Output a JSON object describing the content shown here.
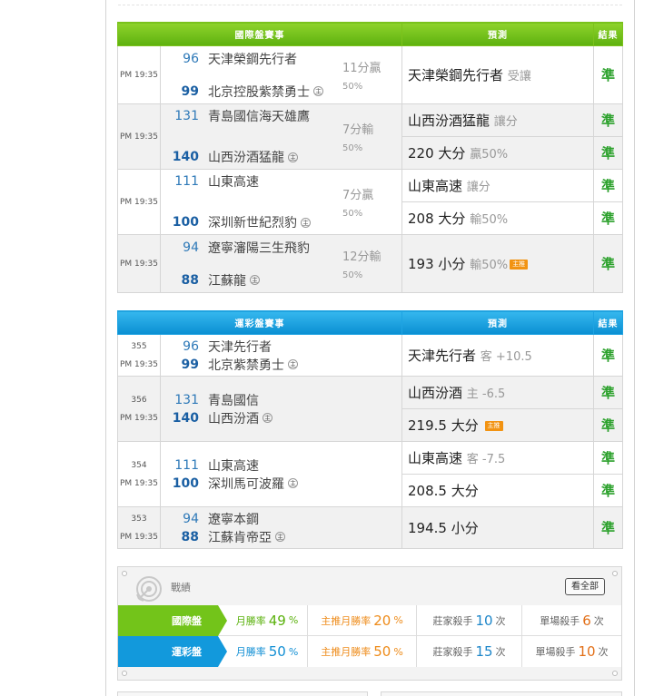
{
  "intl": {
    "header": {
      "games": "國際盤賽事",
      "prediction": "預測",
      "result": "結果"
    },
    "rows": [
      {
        "time": "PM 19:35",
        "away_num": "96",
        "away_name": "天津榮鋼先行者",
        "home_num": "99",
        "home_name": "北京控股紫禁勇士",
        "handicap": "11分贏",
        "handicap_pct": "50%",
        "preds": [
          {
            "main": "天津榮鋼先行者",
            "note": "受讓",
            "result": "準"
          }
        ]
      },
      {
        "time": "PM 19:35",
        "away_num": "131",
        "away_name": "青島國信海天雄鷹",
        "home_num": "140",
        "home_name": "山西汾酒猛龍",
        "handicap": "7分輸",
        "handicap_pct": "50%",
        "preds": [
          {
            "main": "山西汾酒猛龍",
            "note": "讓分",
            "result": "準"
          },
          {
            "main": "220 大分",
            "note": "贏50%",
            "result": "準"
          }
        ]
      },
      {
        "time": "PM 19:35",
        "away_num": "111",
        "away_name": "山東高速",
        "home_num": "100",
        "home_name": "深圳新世紀烈豹",
        "handicap": "7分贏",
        "handicap_pct": "50%",
        "preds": [
          {
            "main": "山東高速",
            "note": "讓分",
            "result": "準"
          },
          {
            "main": "208 大分",
            "note": "輸50%",
            "result": "準"
          }
        ]
      },
      {
        "time": "PM 19:35",
        "away_num": "94",
        "away_name": "遼寧瀋陽三生飛豹",
        "home_num": "88",
        "home_name": "江蘇龍",
        "handicap": "12分輸",
        "handicap_pct": "50%",
        "preds": [
          {
            "main": "193 小分",
            "note": "輸50%",
            "tag": "主推",
            "result": "準"
          }
        ]
      }
    ]
  },
  "lotto": {
    "header": {
      "games": "運彩盤賽事",
      "prediction": "預測",
      "result": "結果"
    },
    "rows": [
      {
        "game_no": "355",
        "time": "PM 19:35",
        "away_num": "96",
        "away_name": "天津先行者",
        "home_num": "99",
        "home_name": "北京紫禁勇士",
        "preds": [
          {
            "main": "天津先行者",
            "note": "客 +10.5",
            "result": "準"
          }
        ]
      },
      {
        "game_no": "356",
        "time": "PM 19:35",
        "away_num": "131",
        "away_name": "青島國信",
        "home_num": "140",
        "home_name": "山西汾酒",
        "preds": [
          {
            "main": "山西汾酒",
            "note": "主 -6.5",
            "result": "準"
          },
          {
            "main": "219.5 大分",
            "note": "",
            "tag": "主推",
            "result": "準"
          }
        ]
      },
      {
        "game_no": "354",
        "time": "PM 19:35",
        "away_num": "111",
        "away_name": "山東高速",
        "home_num": "100",
        "home_name": "深圳馬可波羅",
        "preds": [
          {
            "main": "山東高速",
            "note": "客 -7.5",
            "result": "準"
          },
          {
            "main": "208.5 大分",
            "note": "",
            "result": "準"
          }
        ]
      },
      {
        "game_no": "353",
        "time": "PM 19:35",
        "away_num": "94",
        "away_name": "遼寧本鋼",
        "home_num": "88",
        "home_name": "江蘇肯帝亞",
        "preds": [
          {
            "main": "194.5 小分",
            "note": "",
            "result": "準"
          }
        ]
      }
    ]
  },
  "home_mark": "主",
  "record": {
    "title": "戰績",
    "view_all": "看全部",
    "rows": [
      {
        "label": "國際盤",
        "monthly_label": "月勝率",
        "monthly_value": "49",
        "monthly_unit": "%",
        "top_label": "主推月勝率",
        "top_value": "20",
        "top_unit": "%",
        "killer_label": "莊家殺手",
        "killer_value": "10",
        "killer_unit": "次",
        "single_label": "單場殺手",
        "single_value": "6",
        "single_unit": "次"
      },
      {
        "label": "運彩盤",
        "monthly_label": "月勝率",
        "monthly_value": "50",
        "monthly_unit": "%",
        "top_label": "主推月勝率",
        "top_value": "50",
        "top_unit": "%",
        "killer_label": "莊家殺手",
        "killer_value": "15",
        "killer_unit": "次",
        "single_label": "單場殺手",
        "single_value": "10",
        "single_unit": "次"
      }
    ]
  }
}
